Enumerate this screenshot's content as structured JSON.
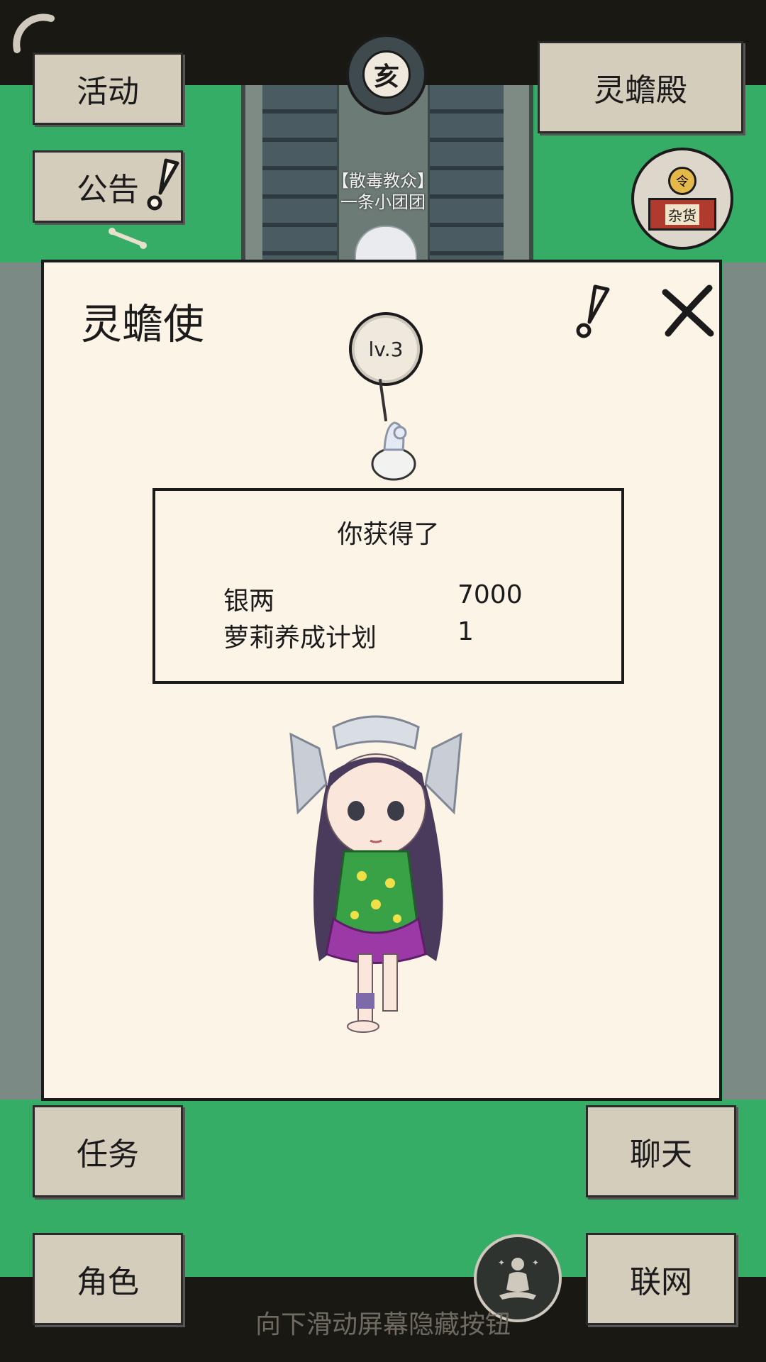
{
  "colors": {
    "grass": "#35ad66",
    "panel": "#fcf5e7",
    "button": "#d4cdbc",
    "ink": "#1b1b1b"
  },
  "top_left": {
    "activity_label": "活动",
    "notice_label": "公告"
  },
  "top_center": {
    "zodiac_char": "亥"
  },
  "top_right": {
    "hall_label": "灵蟾殿",
    "shop_sign": "杂货",
    "shop_token": "令"
  },
  "npc": {
    "faction": "【散毒教众】",
    "name": "一条小团团"
  },
  "dialog": {
    "title": "灵蟾使",
    "level_badge": "lv.3",
    "reward": {
      "heading": "你获得了",
      "items": [
        {
          "name": "银两",
          "qty": "7000"
        },
        {
          "name": "萝莉养成计划",
          "qty": "1"
        }
      ]
    }
  },
  "bottom": {
    "task_label": "任务",
    "role_label": "角色",
    "chat_label": "聊天",
    "network_label": "联网"
  },
  "hint_text": "向下滑动屏幕隐藏按钮",
  "icons": [
    "loading-arc-icon",
    "exclamation-icon",
    "close-icon",
    "zodiac-icon",
    "shop-icon",
    "meditation-icon",
    "bone-icon",
    "pouch-icon"
  ]
}
